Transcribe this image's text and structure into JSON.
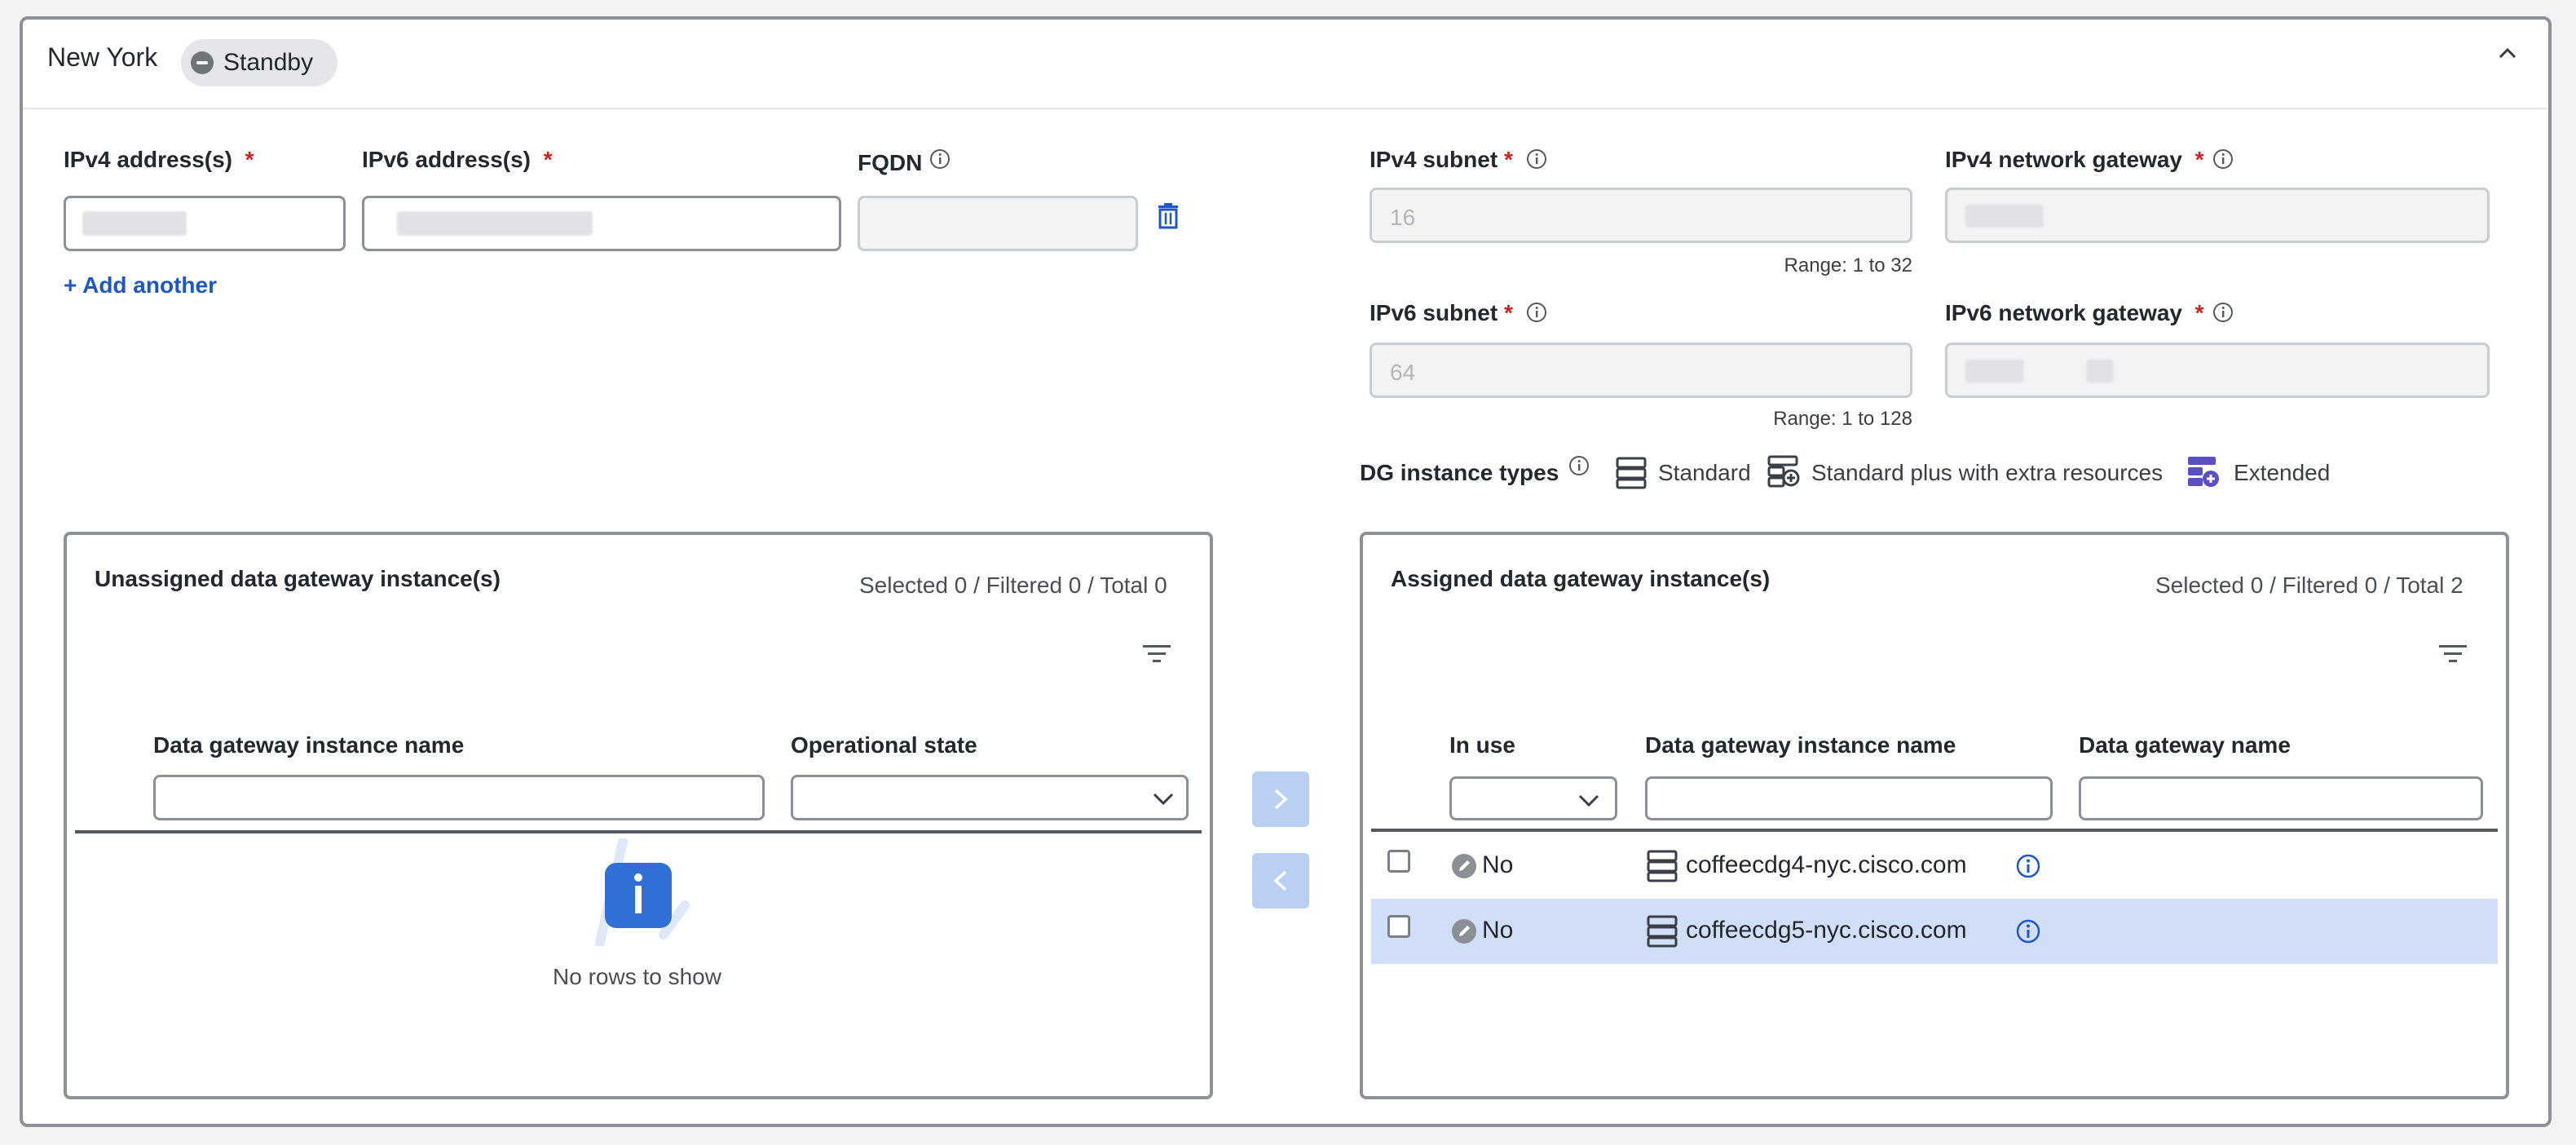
{
  "panel": {
    "title": "New York",
    "status_badge": "Standby"
  },
  "form": {
    "ipv4_address_label": "IPv4 address(s)",
    "ipv6_address_label": "IPv6 address(s)",
    "fqdn_label": "FQDN",
    "required_mark": "*",
    "add_another": "+ Add another",
    "ipv4_subnet_label": "IPv4 subnet",
    "ipv4_subnet_value": "16",
    "ipv4_subnet_range": "Range: 1 to 32",
    "ipv4_gateway_label": "IPv4 network gateway",
    "ipv6_subnet_label": "IPv6 subnet",
    "ipv6_subnet_value": "64",
    "ipv6_subnet_range": "Range: 1 to 128",
    "ipv6_gateway_label": "IPv6 network gateway"
  },
  "dg_types": {
    "label": "DG instance types",
    "standard": "Standard",
    "standard_plus": "Standard plus with extra resources",
    "extended": "Extended"
  },
  "unassigned": {
    "title": "Unassigned data gateway instance(s)",
    "counts": "Selected 0 / Filtered 0 / Total 0",
    "col_name": "Data gateway instance name",
    "col_state": "Operational state",
    "empty": "No rows to show"
  },
  "assigned": {
    "title": "Assigned data gateway instance(s)",
    "counts": "Selected 0 / Filtered 0 / Total 2",
    "col_inuse": "In use",
    "col_instance": "Data gateway instance name",
    "col_gateway": "Data gateway name",
    "rows": [
      {
        "in_use": "No",
        "instance": "coffeecdg4-nyc.cisco.com",
        "gateway": ""
      },
      {
        "in_use": "No",
        "instance": "coffeecdg5-nyc.cisco.com",
        "gateway": ""
      }
    ]
  },
  "colors": {
    "accent": "#1e58c7",
    "required": "#cc2222",
    "selected_row": "#d0dff7",
    "transfer_button": "#b9d0f3"
  },
  "icons": {
    "status": "minus-circle-icon",
    "collapse": "chevron-up-icon",
    "info": "info-circle-icon",
    "delete": "trash-icon",
    "filter": "filter-icon",
    "move_right": "chevron-right-icon",
    "move_left": "chevron-left-icon",
    "server": "server-icon",
    "in_use": "pencil-circle-icon"
  }
}
